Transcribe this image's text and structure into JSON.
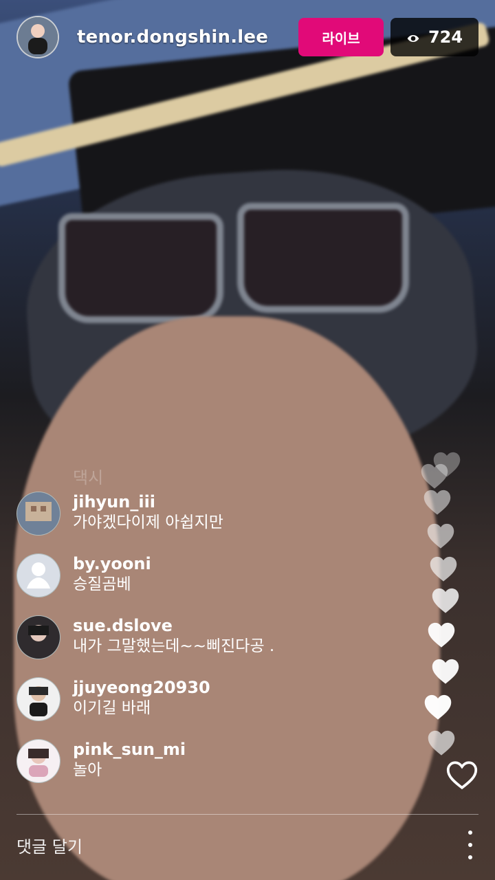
{
  "header": {
    "username": "tenor.dongshin.lee",
    "live_label": "라이브",
    "viewer_count": "724",
    "avatar_icon": "profile-avatar"
  },
  "comments": [
    {
      "name": "jihyun_iii",
      "text": "가야겠다이제 아쉽지만",
      "avatar": "jihyun-avatar"
    },
    {
      "name": "by.yooni",
      "text": "승질곰베",
      "avatar": "default-user-avatar"
    },
    {
      "name": "sue.dslove",
      "text": "내가 그말했는데~~삐진다공 .",
      "avatar": "sue-avatar"
    },
    {
      "name": "jjuyeong20930",
      "text": "이기길 바래",
      "avatar": "jjuyeong-avatar"
    },
    {
      "name": "pink_sun_mi",
      "text": "놀아",
      "avatar": "pink-sun-avatar"
    }
  ],
  "faded_comment": "댁시",
  "input": {
    "placeholder": "댓글 달기"
  },
  "colors": {
    "live": "#e10a78",
    "viewer_bg": "#111111"
  },
  "icons": {
    "viewer": "eye-icon",
    "more": "more-vertical-icon",
    "heart": "heart-icon",
    "outline_heart": "heart-outline-icon"
  }
}
